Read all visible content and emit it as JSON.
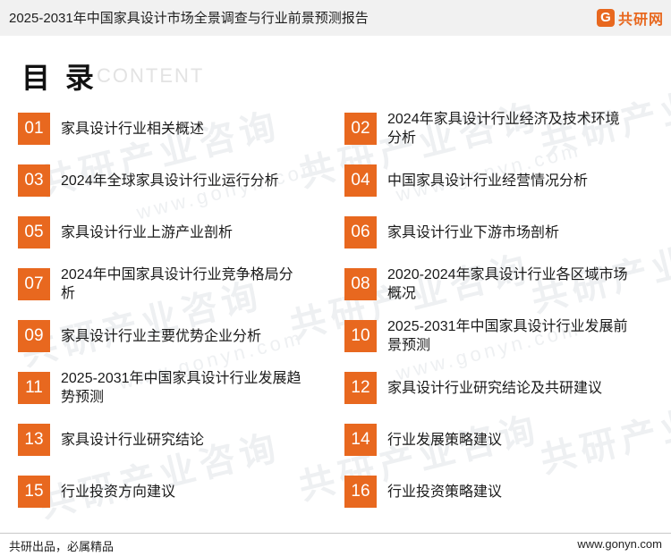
{
  "header": {
    "title": "2025-2031年中国家具设计市场全景调查与行业前景预测报告",
    "logo_mark": "G",
    "logo_text": "共研网"
  },
  "section": {
    "heading": "目 录",
    "subheading": "CONTENT"
  },
  "watermark": {
    "text": "共研产业咨询",
    "url": "www.gonyn.com"
  },
  "toc": {
    "items": [
      {
        "num": "01",
        "label": "家具设计行业相关概述"
      },
      {
        "num": "02",
        "label": "2024年家具设计行业经济及技术环境分析"
      },
      {
        "num": "03",
        "label": "2024年全球家具设计行业运行分析"
      },
      {
        "num": "04",
        "label": "中国家具设计行业经营情况分析"
      },
      {
        "num": "05",
        "label": "家具设计行业上游产业剖析"
      },
      {
        "num": "06",
        "label": "家具设计行业下游市场剖析"
      },
      {
        "num": "07",
        "label": "2024年中国家具设计行业竞争格局分析"
      },
      {
        "num": "08",
        "label": "2020-2024年家具设计行业各区域市场概况"
      },
      {
        "num": "09",
        "label": "家具设计行业主要优势企业分析"
      },
      {
        "num": "10",
        "label": "2025-2031年中国家具设计行业发展前景预测"
      },
      {
        "num": "11",
        "label": "2025-2031年中国家具设计行业发展趋势预测"
      },
      {
        "num": "12",
        "label": "家具设计行业研究结论及共研建议"
      },
      {
        "num": "13",
        "label": "家具设计行业研究结论"
      },
      {
        "num": "14",
        "label": "行业发展策略建议"
      },
      {
        "num": "15",
        "label": "行业投资方向建议"
      },
      {
        "num": "16",
        "label": "行业投资策略建议"
      }
    ]
  },
  "footer": {
    "slogan": "共研出品，必属精品",
    "website": "www.gonyn.com"
  },
  "colors": {
    "accent": "#e8681f",
    "header_bg": "#f1f1f1"
  }
}
